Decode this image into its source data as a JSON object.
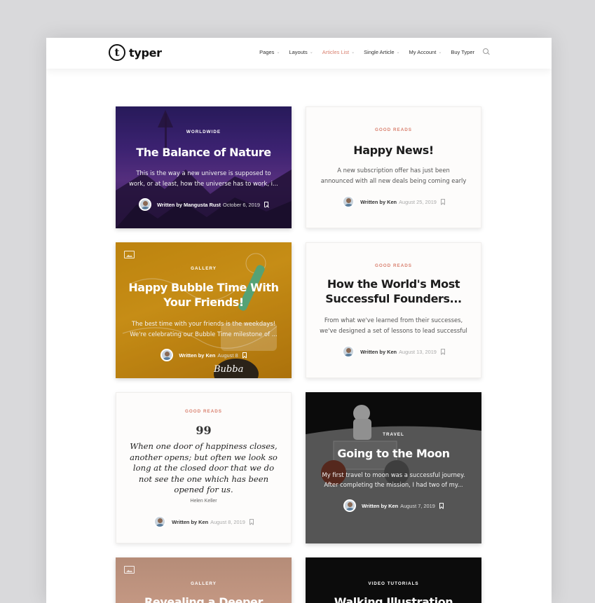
{
  "brand": {
    "logo_letter": "t",
    "name": "typer"
  },
  "nav": {
    "items": [
      {
        "label": "Pages",
        "active": false,
        "has_dropdown": true
      },
      {
        "label": "Layouts",
        "active": false,
        "has_dropdown": true
      },
      {
        "label": "Articles List",
        "active": true,
        "has_dropdown": true
      },
      {
        "label": "Single Article",
        "active": false,
        "has_dropdown": true
      },
      {
        "label": "My Account",
        "active": false,
        "has_dropdown": true
      },
      {
        "label": "Buy Typer",
        "active": false,
        "has_dropdown": false
      }
    ],
    "search_icon": "search-icon"
  },
  "colors": {
    "accent": "#d9806f",
    "page_bg": "#ffffff",
    "outer_bg": "#d9d9db"
  },
  "cards": [
    {
      "kind": "image",
      "category": "Worldwide",
      "title": "The Balance of Nature",
      "excerpt_1": "This is the way a new universe is supposed to",
      "excerpt_2": "work, or at least, how the universe has to work, i...",
      "author": "Written by Mangusta Rust",
      "date": "October 6, 2019"
    },
    {
      "kind": "text",
      "category": "Good Reads",
      "title": "Happy News!",
      "excerpt_1": "A new subscription offer  has just been",
      "excerpt_2": "announced with all new deals being coming early",
      "author": "Written by Ken",
      "date": "August 25, 2019"
    },
    {
      "kind": "image",
      "category": "Gallery",
      "title_1": "Happy Bubble Time With",
      "title_2": "Your Friends!",
      "excerpt_1": "The best time with your friends is the weekdays!",
      "excerpt_2": "We're celebrating our Bubble Time milestone of ...",
      "author": "Written by Ken",
      "date": "August 8",
      "overlay_text": "Bubba"
    },
    {
      "kind": "text",
      "category": "Good Reads",
      "title_1": "How the World's Most",
      "title_2": "Successful Founders...",
      "excerpt_1": "From what we've learned from their successes,",
      "excerpt_2": "we've designed a set of lessons to lead successful",
      "author": "Written by Ken",
      "date": "August 13, 2019"
    },
    {
      "kind": "quote",
      "category": "Good Reads",
      "quote_mark": "99",
      "quote_lines": [
        "When one door of happiness closes,",
        "another opens; but often we look so",
        "long at the closed door that we do",
        "not see the one which has been",
        "opened for us."
      ],
      "quote_author": "Helen Keller",
      "author": "Written by Ken",
      "date": "August 8, 2019"
    },
    {
      "kind": "image",
      "category": "Travel",
      "title": "Going to the Moon",
      "excerpt_1": "My first travel to moon was a successful journey.",
      "excerpt_2": "After completing the mission, I had two of my...",
      "author": "Written by Ken",
      "date": "August 7, 2019"
    },
    {
      "kind": "image",
      "category": "Gallery",
      "title": "Revealing a Deeper"
    },
    {
      "kind": "image",
      "category": "Video Tutorials",
      "title": "Walking Illustration"
    }
  ]
}
